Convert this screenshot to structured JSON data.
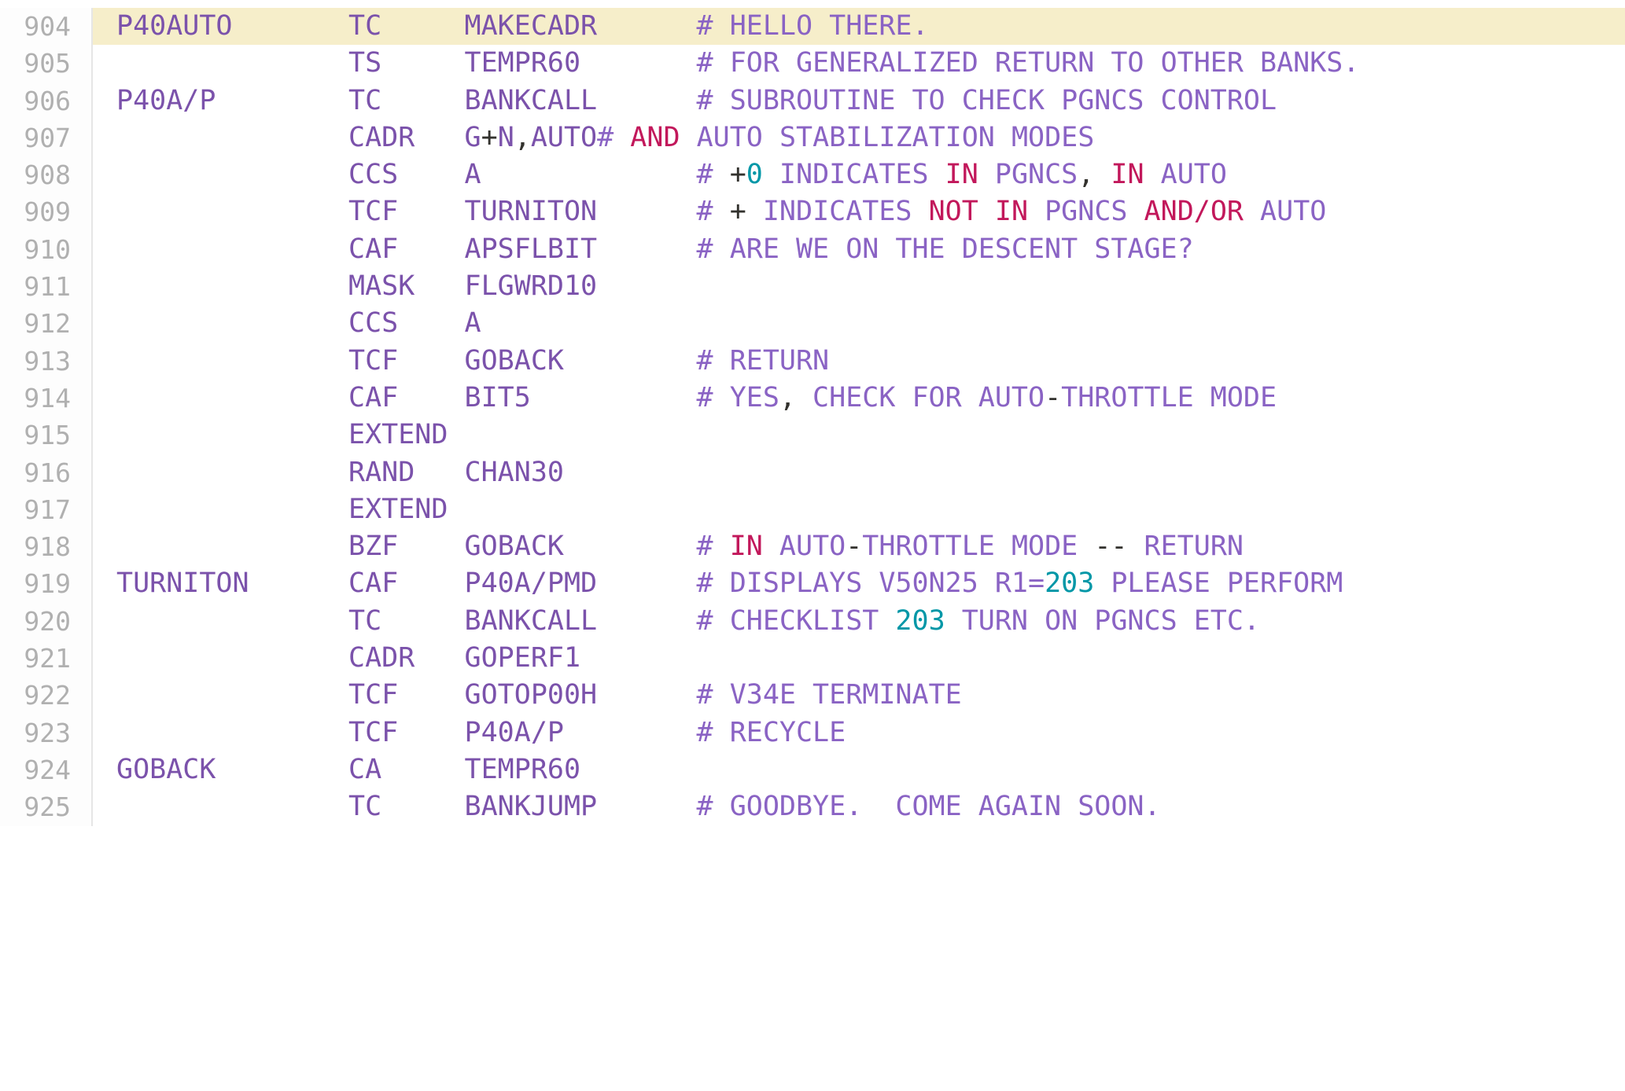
{
  "colors": {
    "background": "#ffffff",
    "gutter_background": "#fdfdfd",
    "gutter_border": "#e6e6e6",
    "line_number": "#b0b0b0",
    "highlight_row": "#f6eeca",
    "code_purple": "#7b52ab",
    "comment_purple": "#8a63c4",
    "keyword_crimson": "#c2185b",
    "number_teal": "#0097a7",
    "punctuation_dark": "#33322e"
  },
  "gutter": {
    "first_line": "904",
    "last_line": "925"
  },
  "lines": [
    {
      "number": "904",
      "highlighted": true,
      "label": "P40AUTO",
      "opcode": "TC",
      "operand": "MAKECADR",
      "tokens": [
        {
          "text": "# HELLO THERE.",
          "kind": "comment"
        }
      ]
    },
    {
      "number": "905",
      "highlighted": false,
      "label": "",
      "opcode": "TS",
      "operand": "TEMPR60",
      "tokens": [
        {
          "text": "# FOR GENERALIZED RETURN TO OTHER BANKS.",
          "kind": "comment"
        }
      ]
    },
    {
      "number": "906",
      "highlighted": false,
      "label": "P40A/P",
      "opcode": "TC",
      "operand": "BANKCALL",
      "tokens": [
        {
          "text": "# SUBROUTINE TO CHECK PGNCS CONTROL",
          "kind": "comment"
        }
      ]
    },
    {
      "number": "907",
      "highlighted": false,
      "label": "",
      "opcode": "CADR",
      "operand_tokens": [
        {
          "text": "G",
          "kind": "operand"
        },
        {
          "text": "+",
          "kind": "punct"
        },
        {
          "text": "N",
          "kind": "operand"
        },
        {
          "text": ",",
          "kind": "punct"
        },
        {
          "text": "AUTO",
          "kind": "operand"
        }
      ],
      "tokens": [
        {
          "text": "# ",
          "kind": "comment"
        },
        {
          "text": "AND",
          "kind": "keyword"
        },
        {
          "text": " AUTO STABILIZATION MODES",
          "kind": "comment"
        }
      ],
      "no_comment_gap": true
    },
    {
      "number": "908",
      "highlighted": false,
      "label": "",
      "opcode": "CCS",
      "operand": "A",
      "tokens": [
        {
          "text": "# ",
          "kind": "comment"
        },
        {
          "text": "+",
          "kind": "punct"
        },
        {
          "text": "0",
          "kind": "number"
        },
        {
          "text": " INDICATES ",
          "kind": "comment"
        },
        {
          "text": "IN",
          "kind": "keyword"
        },
        {
          "text": " PGNCS",
          "kind": "comment"
        },
        {
          "text": ",",
          "kind": "punct"
        },
        {
          "text": " ",
          "kind": "comment"
        },
        {
          "text": "IN",
          "kind": "keyword"
        },
        {
          "text": " AUTO",
          "kind": "comment"
        }
      ]
    },
    {
      "number": "909",
      "highlighted": false,
      "label": "",
      "opcode": "TCF",
      "operand": "TURNITON",
      "tokens": [
        {
          "text": "# ",
          "kind": "comment"
        },
        {
          "text": "+",
          "kind": "punct"
        },
        {
          "text": " INDICATES ",
          "kind": "comment"
        },
        {
          "text": "NOT",
          "kind": "keyword"
        },
        {
          "text": " ",
          "kind": "comment"
        },
        {
          "text": "IN",
          "kind": "keyword"
        },
        {
          "text": " PGNCS ",
          "kind": "comment"
        },
        {
          "text": "AND/OR",
          "kind": "keyword"
        },
        {
          "text": " AUTO",
          "kind": "comment"
        }
      ]
    },
    {
      "number": "910",
      "highlighted": false,
      "label": "",
      "opcode": "CAF",
      "operand": "APSFLBIT",
      "tokens": [
        {
          "text": "# ARE WE ON THE DESCENT STAGE?",
          "kind": "comment"
        }
      ]
    },
    {
      "number": "911",
      "highlighted": false,
      "label": "",
      "opcode": "MASK",
      "operand": "FLGWRD10",
      "tokens": []
    },
    {
      "number": "912",
      "highlighted": false,
      "label": "",
      "opcode": "CCS",
      "operand": "A",
      "tokens": []
    },
    {
      "number": "913",
      "highlighted": false,
      "label": "",
      "opcode": "TCF",
      "operand": "GOBACK",
      "tokens": [
        {
          "text": "# RETURN",
          "kind": "comment"
        }
      ]
    },
    {
      "number": "914",
      "highlighted": false,
      "label": "",
      "opcode": "CAF",
      "operand": "BIT5",
      "tokens": [
        {
          "text": "# YES",
          "kind": "comment"
        },
        {
          "text": ",",
          "kind": "punct"
        },
        {
          "text": " CHECK FOR AUTO",
          "kind": "comment"
        },
        {
          "text": "-",
          "kind": "punct"
        },
        {
          "text": "THROTTLE MODE",
          "kind": "comment"
        }
      ]
    },
    {
      "number": "915",
      "highlighted": false,
      "label": "",
      "opcode": "EXTEND",
      "operand": "",
      "tokens": []
    },
    {
      "number": "916",
      "highlighted": false,
      "label": "",
      "opcode": "RAND",
      "operand": "CHAN30",
      "tokens": []
    },
    {
      "number": "917",
      "highlighted": false,
      "label": "",
      "opcode": "EXTEND",
      "operand": "",
      "tokens": []
    },
    {
      "number": "918",
      "highlighted": false,
      "label": "",
      "opcode": "BZF",
      "operand": "GOBACK",
      "tokens": [
        {
          "text": "# ",
          "kind": "comment"
        },
        {
          "text": "IN",
          "kind": "keyword"
        },
        {
          "text": " AUTO",
          "kind": "comment"
        },
        {
          "text": "-",
          "kind": "punct"
        },
        {
          "text": "THROTTLE MODE ",
          "kind": "comment"
        },
        {
          "text": "--",
          "kind": "punct"
        },
        {
          "text": " RETURN",
          "kind": "comment"
        }
      ]
    },
    {
      "number": "919",
      "highlighted": false,
      "label": "TURNITON",
      "opcode": "CAF",
      "operand": "P40A/PMD",
      "tokens": [
        {
          "text": "# DISPLAYS V50N25 R1",
          "kind": "comment"
        },
        {
          "text": "=",
          "kind": "comment"
        },
        {
          "text": "203",
          "kind": "number"
        },
        {
          "text": " PLEASE PERFORM",
          "kind": "comment"
        }
      ]
    },
    {
      "number": "920",
      "highlighted": false,
      "label": "",
      "opcode": "TC",
      "operand": "BANKCALL",
      "tokens": [
        {
          "text": "# CHECKLIST ",
          "kind": "comment"
        },
        {
          "text": "203",
          "kind": "number"
        },
        {
          "text": " TURN ON PGNCS ETC.",
          "kind": "comment"
        }
      ]
    },
    {
      "number": "921",
      "highlighted": false,
      "label": "",
      "opcode": "CADR",
      "operand": "GOPERF1",
      "tokens": []
    },
    {
      "number": "922",
      "highlighted": false,
      "label": "",
      "opcode": "TCF",
      "operand": "GOTOP00H",
      "tokens": [
        {
          "text": "# V34E TERMINATE",
          "kind": "comment"
        }
      ]
    },
    {
      "number": "923",
      "highlighted": false,
      "label": "",
      "opcode": "TCF",
      "operand": "P40A/P",
      "tokens": [
        {
          "text": "# RECYCLE",
          "kind": "comment"
        }
      ]
    },
    {
      "number": "924",
      "highlighted": false,
      "label": "GOBACK",
      "opcode": "CA",
      "operand": "TEMPR60",
      "tokens": []
    },
    {
      "number": "925",
      "highlighted": false,
      "label": "",
      "opcode": "TC",
      "operand": "BANKJUMP",
      "tokens": [
        {
          "text": "# GOODBYE.  COME AGAIN SOON.",
          "kind": "comment"
        }
      ]
    }
  ],
  "layout": {
    "label_col_chars": 14,
    "opcode_col_chars": 7,
    "operand_col_chars": 14
  }
}
